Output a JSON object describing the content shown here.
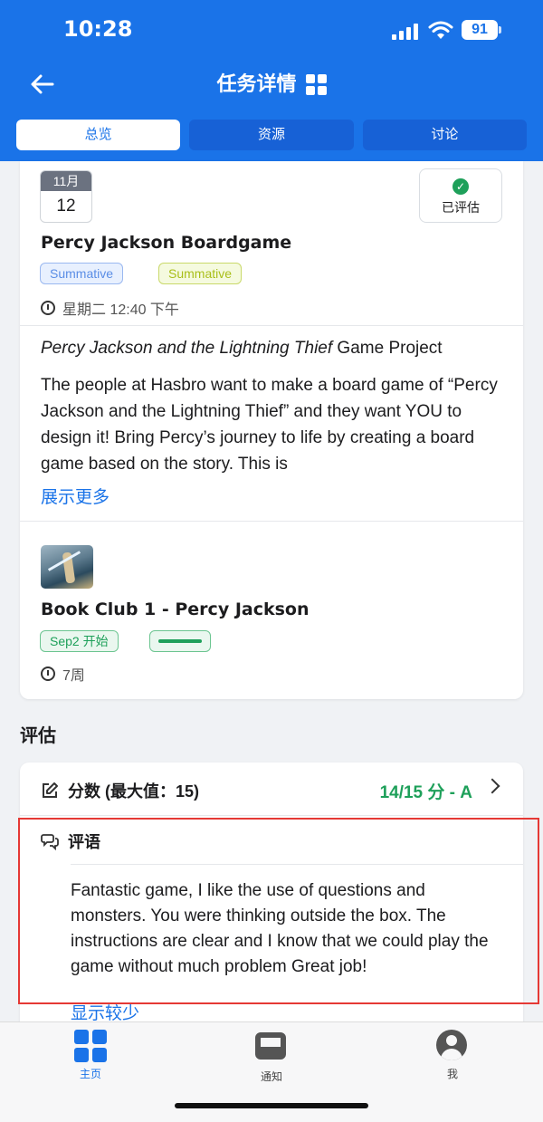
{
  "status_bar": {
    "time": "10:28",
    "battery": "91"
  },
  "header": {
    "title": "任务详情"
  },
  "tabs": [
    {
      "label": "总览",
      "active": true
    },
    {
      "label": "资源",
      "active": false
    },
    {
      "label": "讨论",
      "active": false
    }
  ],
  "assignment": {
    "month": "11月",
    "day": "12",
    "graded_label": "已评估",
    "title": "Percy Jackson Boardgame",
    "tags": [
      "Summative",
      "Summative"
    ],
    "due": "星期二 12:40 下午",
    "project_title_italic": "Percy Jackson and the Lightning Thief",
    "project_title_rest": " Game Project",
    "description": "The people at Hasbro want to make a board game of “Percy Jackson and the Lightning Thief” and they want YOU to design it! Bring Percy’s journey to life by creating a board game based on the story. This is",
    "show_more": "展示更多"
  },
  "unit": {
    "title": "Book Club 1 - Percy Jackson",
    "start_tag": "Sep2 开始",
    "progress_fraction": 1.0,
    "duration": "7周"
  },
  "assessment": {
    "section_title": "评估",
    "score_label": "分数 (最大值：15)",
    "score_value": "14/15 分 - A",
    "comment_label": "评语",
    "comment": "Fantastic game, I like the use of questions and monsters. You were thinking outside the box. The instructions are clear and I know that we could play the game without much problem Great job!",
    "show_less": "显示较少"
  },
  "tabbar": [
    {
      "label": "主页",
      "icon": "home-grid-icon",
      "active": true
    },
    {
      "label": "通知",
      "icon": "inbox-tray-icon",
      "active": false
    },
    {
      "label": "我",
      "icon": "profile-avatar-icon",
      "active": false
    }
  ],
  "colors": {
    "primary": "#1a73e8",
    "success": "#1ea05a",
    "highlight": "#e53935"
  }
}
